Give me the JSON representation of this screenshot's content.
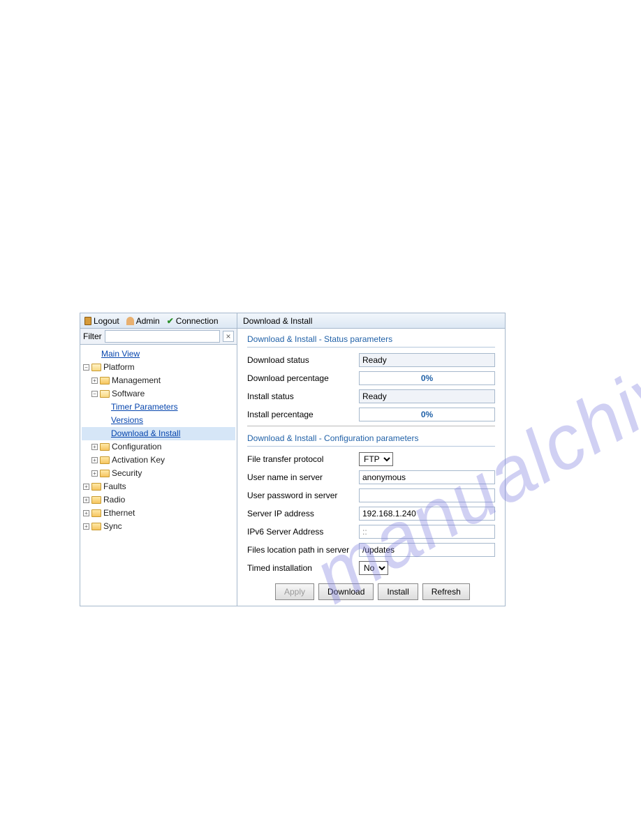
{
  "toolbar": {
    "logout": "Logout",
    "admin": "Admin",
    "connection": "Connection"
  },
  "filter": {
    "label": "Filter",
    "value": ""
  },
  "tree": {
    "main_view": "Main View",
    "platform": "Platform",
    "management": "Management",
    "software": "Software",
    "timer_parameters": "Timer Parameters",
    "versions": "Versions",
    "download_install": "Download & Install",
    "configuration": "Configuration",
    "activation_key": "Activation Key",
    "security": "Security",
    "faults": "Faults",
    "radio": "Radio",
    "ethernet": "Ethernet",
    "sync": "Sync"
  },
  "main": {
    "title": "Download & Install",
    "status_section_title": "Download & Install - Status parameters",
    "status": {
      "download_status_label": "Download status",
      "download_status_value": "Ready",
      "download_percentage_label": "Download percentage",
      "download_percentage_value": "0%",
      "install_status_label": "Install status",
      "install_status_value": "Ready",
      "install_percentage_label": "Install percentage",
      "install_percentage_value": "0%"
    },
    "config_section_title": "Download & Install - Configuration parameters",
    "config": {
      "protocol_label": "File transfer protocol",
      "protocol_value": "FTP",
      "username_label": "User name in server",
      "username_value": "anonymous",
      "password_label": "User password in server",
      "password_value": "",
      "server_ip_label": "Server IP address",
      "server_ip_value": "192.168.1.240",
      "ipv6_label": "IPv6 Server Address",
      "ipv6_value": "::",
      "path_label": "Files location path in server",
      "path_value": "/updates",
      "timed_label": "Timed installation",
      "timed_value": "No"
    },
    "buttons": {
      "apply": "Apply",
      "download": "Download",
      "install": "Install",
      "refresh": "Refresh"
    }
  }
}
